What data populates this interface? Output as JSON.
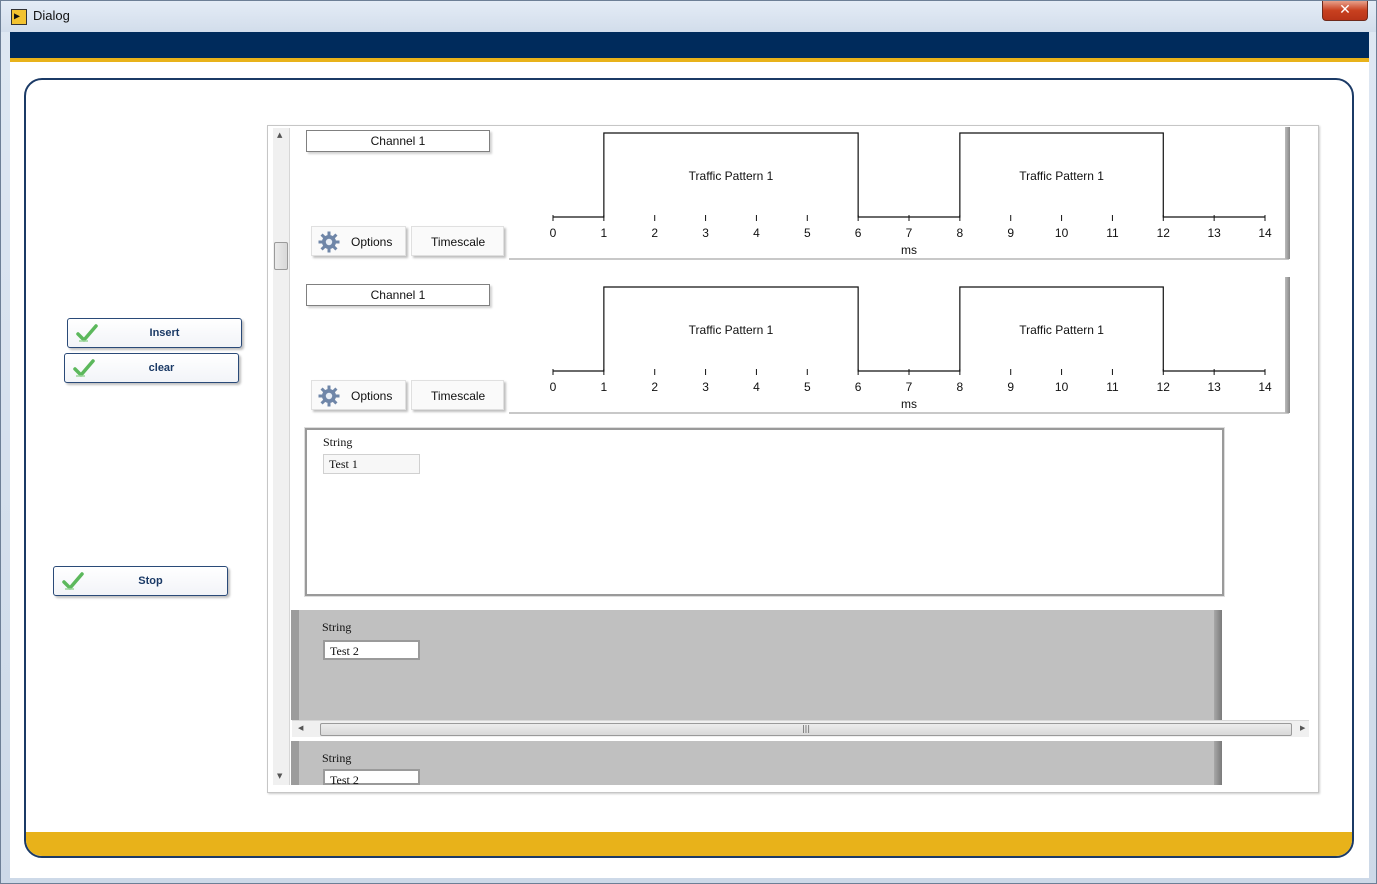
{
  "window": {
    "title": "Dialog",
    "close_glyph": "✕"
  },
  "colors": {
    "band_navy": "#002b5c",
    "band_gold": "#e8b21a",
    "panel_gray": "#c0c0c0"
  },
  "left_buttons": {
    "insert": "Insert",
    "clear": "clear",
    "stop": "Stop"
  },
  "array": {
    "elements": [
      {
        "channel_name": "Channel 1",
        "options_label": "Options",
        "timescale_label": "Timescale",
        "chart_data": {
          "type": "line",
          "xlabel": "ms",
          "xlim": [
            0,
            14
          ],
          "x_ticks": [
            "0",
            "1",
            "2",
            "3",
            "4",
            "5",
            "6",
            "7",
            "8",
            "9",
            "10",
            "11",
            "12",
            "13",
            "14"
          ],
          "pulses": [
            {
              "start": 1,
              "end": 6,
              "label": "Traffic Pattern 1"
            },
            {
              "start": 8,
              "end": 12,
              "label": "Traffic Pattern 1"
            }
          ]
        }
      },
      {
        "channel_name": "Channel 1",
        "options_label": "Options",
        "timescale_label": "Timescale",
        "chart_data": {
          "type": "line",
          "xlabel": "ms",
          "xlim": [
            0,
            14
          ],
          "x_ticks": [
            "0",
            "1",
            "2",
            "3",
            "4",
            "5",
            "6",
            "7",
            "8",
            "9",
            "10",
            "11",
            "12",
            "13",
            "14"
          ],
          "pulses": [
            {
              "start": 1,
              "end": 6,
              "label": "Traffic Pattern 1"
            },
            {
              "start": 8,
              "end": 12,
              "label": "Traffic Pattern 1"
            }
          ]
        }
      }
    ]
  },
  "strings": [
    {
      "label": "String",
      "value": "Test 1"
    },
    {
      "label": "String",
      "value": "Test 2"
    },
    {
      "label": "String",
      "value": "Test 2"
    }
  ],
  "scroll": {
    "up": "▲",
    "down": "▼",
    "left": "◀",
    "right": "▶",
    "grip": "|||"
  }
}
